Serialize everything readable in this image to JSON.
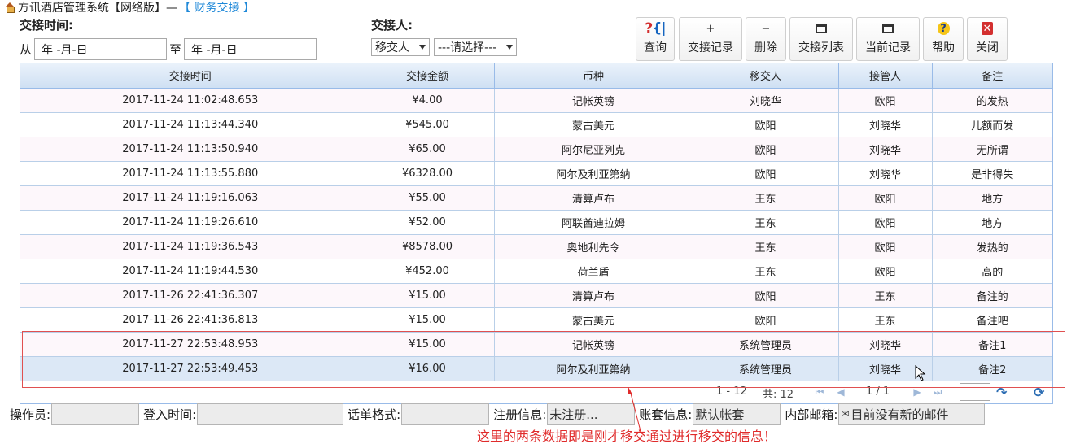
{
  "title": {
    "app": "方讯酒店管理系统【网络版】—",
    "module": "【 财务交接 】"
  },
  "filters": {
    "time_label": "交接时间:",
    "from_label": "从",
    "to_label": "至",
    "from_value": "年 -月-日",
    "to_value": "年 -月-日",
    "person_label": "交接人:",
    "person_role_value": "移交人",
    "person_select_value": "---请选择---"
  },
  "toolbar": {
    "query": "查询",
    "records": "交接记录",
    "delete": "删除",
    "list": "交接列表",
    "current": "当前记录",
    "help": "帮助",
    "close": "关闭"
  },
  "table": {
    "headers": [
      "交接时间",
      "交接金额",
      "币种",
      "移交人",
      "接管人",
      "备注"
    ],
    "rows": [
      [
        "2017-11-24 11:02:48.653",
        "¥4.00",
        "记帐英镑",
        "刘晓华",
        "欧阳",
        "的发热"
      ],
      [
        "2017-11-24 11:13:44.340",
        "¥545.00",
        "蒙古美元",
        "欧阳",
        "刘晓华",
        "儿额而发"
      ],
      [
        "2017-11-24 11:13:50.940",
        "¥65.00",
        "阿尔尼亚列克",
        "欧阳",
        "刘晓华",
        "无所谓"
      ],
      [
        "2017-11-24 11:13:55.880",
        "¥6328.00",
        "阿尔及利亚第纳",
        "欧阳",
        "刘晓华",
        "是非得失"
      ],
      [
        "2017-11-24 11:19:16.063",
        "¥55.00",
        "清算卢布",
        "王东",
        "欧阳",
        "地方"
      ],
      [
        "2017-11-24 11:19:26.610",
        "¥52.00",
        "阿联酋迪拉姆",
        "王东",
        "欧阳",
        "地方"
      ],
      [
        "2017-11-24 11:19:36.543",
        "¥8578.00",
        "奥地利先令",
        "王东",
        "欧阳",
        "发热的"
      ],
      [
        "2017-11-24 11:19:44.530",
        "¥452.00",
        "荷兰盾",
        "王东",
        "欧阳",
        "高的"
      ],
      [
        "2017-11-26 22:41:36.307",
        "¥15.00",
        "清算卢布",
        "欧阳",
        "王东",
        "备注的"
      ],
      [
        "2017-11-26 22:41:36.813",
        "¥15.00",
        "蒙古美元",
        "欧阳",
        "王东",
        "备注吧"
      ],
      [
        "2017-11-27 22:53:48.953",
        "¥15.00",
        "记帐英镑",
        "系统管理员",
        "刘晓华",
        "备注1"
      ],
      [
        "2017-11-27 22:53:49.453",
        "¥16.00",
        "阿尔及利亚第纳",
        "系统管理员",
        "刘晓华",
        "备注2"
      ]
    ],
    "selected_row": 11
  },
  "pager": {
    "range": "1 - 12",
    "total": "共: 12",
    "page": "1 / 1"
  },
  "status": {
    "operator_label": "操作员:",
    "operator_value": "",
    "login_label": "登入时间:",
    "login_value": "",
    "format_label": "话单格式:",
    "format_value": "",
    "register_label": "注册信息:",
    "register_value": "未注册...",
    "account_label": "账套信息:",
    "account_value": "默认帐套",
    "mail_label": "内部邮箱:",
    "mail_value": "目前没有新的邮件"
  },
  "annotation": "这里的两条数据即是刚才移交通过进行移交的信息！",
  "colors": {
    "grid_border": "#99bbe8",
    "header_bg": "#cfe0f3",
    "selected_row": "#dce8f6",
    "annotation": "#e02b2b",
    "module_title": "#1e88d8"
  }
}
